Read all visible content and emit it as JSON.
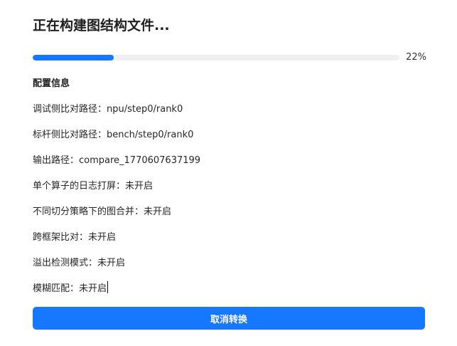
{
  "dialog": {
    "title": "正在构建图结构文件..."
  },
  "progress": {
    "value": 22,
    "label": "22%",
    "color": "#1677ff"
  },
  "config": {
    "section_title": "配置信息",
    "items": [
      "调试侧比对路径：npu/step0/rank0",
      "标杆侧比对路径：bench/step0/rank0",
      "输出路径：compare_1770607637199",
      "单个算子的日志打屏：未开启",
      "不同切分策略下的图合并：未开启",
      "跨框架比对：未开启",
      "溢出检测模式：未开启",
      "模糊匹配：未开启"
    ]
  },
  "actions": {
    "cancel_label": "取消转换"
  }
}
